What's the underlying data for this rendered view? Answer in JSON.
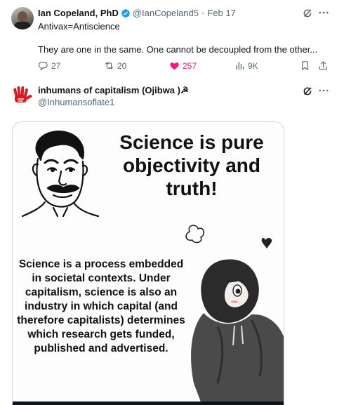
{
  "tweet1": {
    "author_name": "Ian Copeland, PhD",
    "handle": "@IanCopeland5",
    "separator": "·",
    "date": "Feb 17",
    "line1": "Antivax=Antiscience",
    "line2": "They are one in the same. One cannot be decoupled from the other...",
    "reply_count": "27",
    "repost_count": "20",
    "like_count": "257",
    "view_count": "9K",
    "colors": {
      "like": "#f91880",
      "verified": "#1d9bf0",
      "muted": "#536471"
    }
  },
  "tweet2": {
    "author_name": "inhumans of capitalism (Ojibwa )☭",
    "handle": "@Inhumansoflate1",
    "meme": {
      "title": "Science is pure objectivity and truth!",
      "body": "Science is a process embedded in societal contexts. Under capitalism, science is also an industry in which capital (and therefore capitalists) determines which research gets funded, published and advertised."
    }
  },
  "icons": [
    "verified-badge-icon",
    "grok-icon",
    "more-icon",
    "reply-icon",
    "repost-icon",
    "like-icon",
    "views-icon",
    "bookmark-icon",
    "share-icon",
    "red-hand-avatar"
  ]
}
